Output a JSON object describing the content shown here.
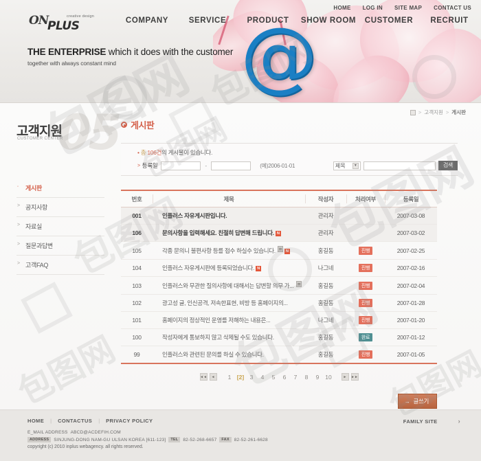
{
  "topnav": [
    {
      "label": "HOME"
    },
    {
      "label": "LOG IN"
    },
    {
      "label": "SITE MAP"
    },
    {
      "label": "CONTACT US"
    }
  ],
  "logo": {
    "on": "ON",
    "plus": "PLUS",
    "tagline": "creative design"
  },
  "mainnav": [
    {
      "label": "COMPANY"
    },
    {
      "label": "SERVICE"
    },
    {
      "label": "PRODUCT"
    },
    {
      "label": "SHOW ROOM"
    },
    {
      "label": "CUSTOMER"
    },
    {
      "label": "RECRUIT"
    }
  ],
  "banner": {
    "bold": "THE ENTERPRISE",
    "rest": " which it does with the customer",
    "sub": "together with always constant mind",
    "at_glyph": "@"
  },
  "breadcrumb": {
    "home_icon": "home-icon",
    "sep1": ">",
    "level1": "고객지원",
    "sep2": ">",
    "current": "게시판"
  },
  "sidebar": {
    "title_kr": "고객지원",
    "title_en": "CUSTOMER CENTER",
    "number": "05",
    "items": [
      {
        "label": "게시판",
        "marker": "◦",
        "active": true
      },
      {
        "label": "공지사항",
        "marker": ">",
        "active": false
      },
      {
        "label": "자료실",
        "marker": ">",
        "active": false
      },
      {
        "label": "질문과답변",
        "marker": ">",
        "active": false
      },
      {
        "label": "고객FAQ",
        "marker": ">",
        "active": false
      }
    ]
  },
  "content": {
    "title": "게시판",
    "count_star": "•",
    "count_prefix": "총",
    "count_value": "106건",
    "count_suffix": "의 게시물이 있습니다.",
    "filter": {
      "arrow": ">",
      "label": "등록일",
      "date_from": "",
      "date_to": "",
      "dash": "-",
      "example": "(예)2006-01-01",
      "select_value": "제목",
      "select_caret": "▼",
      "keyword": "",
      "search_button": "검색"
    }
  },
  "table": {
    "headers": [
      "번호",
      "제목",
      "작성자",
      "처리여부",
      "등록일"
    ],
    "rows": [
      {
        "num": "001",
        "title": "인플러스 자유게시판입니다.",
        "writer": "관리자",
        "state": "",
        "state_type": "",
        "date": "2007-03-08",
        "highlight": true,
        "new": false,
        "file": false
      },
      {
        "num": "106",
        "title": "문의사항을 입력해세요. 친절히 답변해 드립니다.",
        "writer": "관리자",
        "state": "",
        "state_type": "",
        "date": "2007-03-02",
        "highlight": true,
        "new": true,
        "file": false
      },
      {
        "num": "105",
        "title": "각종 문의니 불편사항 등를 접수 하실수 있습니다.",
        "writer": "홍길동",
        "state": "진행",
        "state_type": "prog",
        "date": "2007-02-25",
        "highlight": false,
        "new": true,
        "file": true
      },
      {
        "num": "104",
        "title": "인플러스 자유게시판에 등록되었습니다.",
        "writer": "나그네",
        "state": "진행",
        "state_type": "prog",
        "date": "2007-02-16",
        "highlight": false,
        "new": true,
        "file": false
      },
      {
        "num": "103",
        "title": "인플러스와 무관한 질의사항에 대해서는 답변할 의무 가...",
        "writer": "홍길동",
        "state": "진행",
        "state_type": "prog",
        "date": "2007-02-04",
        "highlight": false,
        "new": false,
        "file": true
      },
      {
        "num": "102",
        "title": "광고성 글, 인신공격, 저속한표현, 비방 등 홈페이지의...",
        "writer": "홍길동",
        "state": "진행",
        "state_type": "prog",
        "date": "2007-01-28",
        "highlight": false,
        "new": false,
        "file": false
      },
      {
        "num": "101",
        "title": "홈페이지의 정상적인 운영를 저해하는 내용은...",
        "writer": "나그네",
        "state": "진행",
        "state_type": "prog",
        "date": "2007-01-20",
        "highlight": false,
        "new": false,
        "file": false
      },
      {
        "num": "100",
        "title": "작성자에게 통보하지 않고 삭제될 수도 있습니다.",
        "writer": "홍길동",
        "state": "완료",
        "state_type": "done",
        "date": "2007-01-12",
        "highlight": false,
        "new": false,
        "file": false
      },
      {
        "num": "99",
        "title": "인플러스와 관련된 문의를 하실 수 있습니다.",
        "writer": "홍길동",
        "state": "진행",
        "state_type": "prog",
        "date": "2007-01-05",
        "highlight": false,
        "new": false,
        "file": false
      }
    ]
  },
  "pager": {
    "first": "◄◄",
    "prev": "◄",
    "pages": [
      "1",
      "[2]",
      "3",
      "4",
      "5",
      "6",
      "7",
      "8",
      "9",
      "10"
    ],
    "current": "[2]",
    "next": "►",
    "last": "►►"
  },
  "write_button": {
    "arrow": "→",
    "label": "글쓰기"
  },
  "footer": {
    "links": [
      "HOME",
      "CONTACTUS",
      "PRIVACY POLICY"
    ],
    "separator": "|",
    "family_site": "FAMILY SITE",
    "family_arrow": "›",
    "email_label": "E_MAIL ADDRESS",
    "email_value": "ABCD@ACDEFIH.COM",
    "address_tag": "ADDRESS",
    "address_value": "SINJUNG-DONG NAM-GU ULSAN KOREA  [611-123]",
    "tel_tag": "TEL",
    "tel_value": "82-52-268-6657",
    "fax_tag": "FAX",
    "fax_value": "82-52-261-6628",
    "copyright": "copyright (c) 2010 inplus webagency. all rights reserved."
  },
  "watermark": {
    "text": "包图网",
    "mark": "6"
  }
}
